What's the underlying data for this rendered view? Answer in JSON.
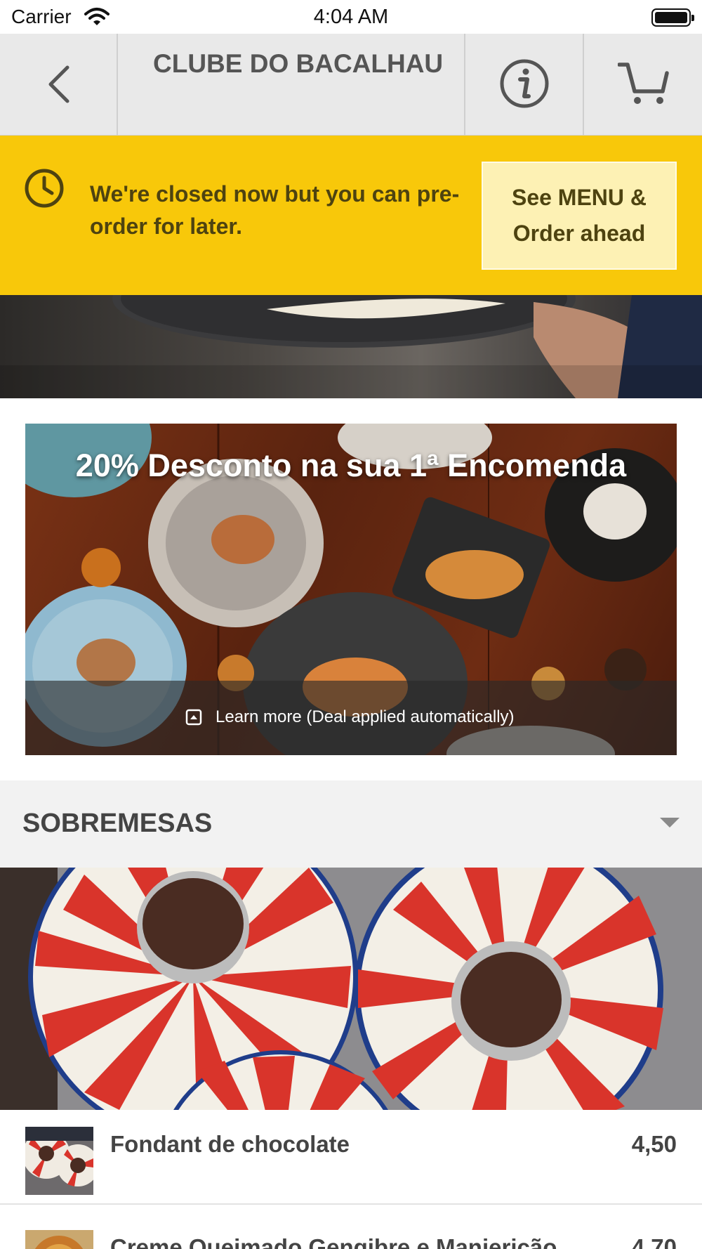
{
  "status_bar": {
    "carrier": "Carrier",
    "time": "4:04 AM"
  },
  "header": {
    "title": "CLUBE DO BACALHAU",
    "back_icon": "chevron-left-icon",
    "info_icon": "info-icon",
    "cart_icon": "cart-icon"
  },
  "banner": {
    "icon": "clock-icon",
    "message": "We're closed now but you can pre-order for later.",
    "button_label": "See MENU & Order ahead",
    "color": "#f8c80a"
  },
  "promo": {
    "title": "20% Desconto na sua 1ª Encomenda",
    "footer_icon": "expand-up-icon",
    "footer_text": "Learn more (Deal applied automatically)"
  },
  "section": {
    "title": "SOBREMESAS",
    "chevron_icon": "chevron-down-icon"
  },
  "items": [
    {
      "name": "Fondant de chocolate",
      "price": "4,50"
    },
    {
      "name": "Creme Queimado Gengibre e Manjericão",
      "price": "4,70"
    }
  ]
}
